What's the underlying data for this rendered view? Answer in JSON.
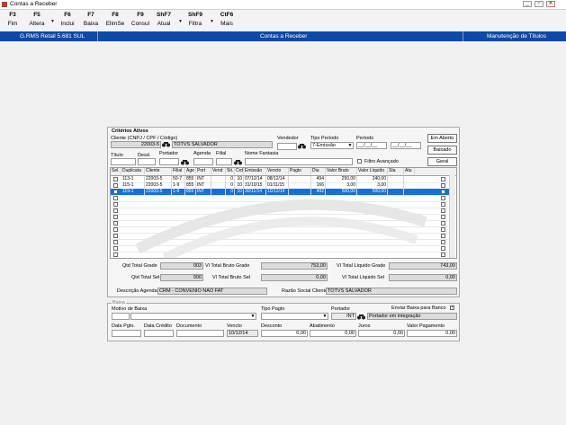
{
  "window": {
    "title": "Contas a Receber",
    "controls": [
      "_",
      "▫",
      "✕"
    ]
  },
  "toolbar": [
    {
      "key": "F3",
      "label": "Fim",
      "arrow": false
    },
    {
      "key": "F5",
      "label": "Altera",
      "arrow": true
    },
    {
      "key": "F6",
      "label": "Inclui",
      "arrow": false
    },
    {
      "key": "F7",
      "label": "Baixa",
      "arrow": false
    },
    {
      "key": "F8",
      "label": "ElimSe",
      "arrow": false
    },
    {
      "key": "F9",
      "label": "Consul",
      "arrow": false
    },
    {
      "key": "ShF7",
      "label": "Atual",
      "arrow": true
    },
    {
      "key": "ShF9",
      "label": "Filtra",
      "arrow": true
    },
    {
      "key": "CtF6",
      "label": "Mais",
      "arrow": false
    }
  ],
  "header_bar": {
    "product": "G.RMS Retail 5.681 SUL",
    "module": "Contas a Receber",
    "screen": "Manutenção de Títulos"
  },
  "criteria": {
    "section_title": "Critérios Ativos",
    "client_label": "Cliente (CNPJ / CPF / Código)",
    "client_code": "22003-5",
    "client_name": "TOTVS SALVADOR",
    "seller_label": "Vendedor",
    "seller_value": "",
    "period_type_label": "Tipo Período",
    "period_type_value": "7-Emissão",
    "period_label": "Período",
    "period_from": "__/__/__",
    "period_to": "__/__/__",
    "title_label": "Título",
    "desd_label": "Desd.",
    "portador_label": "Portador",
    "agenda_label": "Agenda",
    "filial_label": "Filial",
    "fantasia_label": "Nome Fantasia",
    "advanced_filter_label": "Filtro Avançado",
    "buttons": {
      "open": "Em Aberto",
      "paid": "Baixado",
      "general": "Geral"
    }
  },
  "grid": {
    "columns": [
      "Sel.",
      "Duplicata",
      "Cliente",
      "Filial",
      "Age",
      "Port",
      "Vend",
      "Sit.",
      "Crd",
      "Emissão",
      "Vencto",
      "Pagto",
      "Dia",
      "Valor Bruto",
      "Valor Líquido",
      "Sta",
      "Atu"
    ],
    "rows": [
      {
        "dup": "113-1",
        "cliente": "22003-5",
        "filial": "50-7",
        "age": "855",
        "port": "INT",
        "vend": "",
        "sit": "0",
        "crd": "10",
        "emissao": "07/12/14",
        "vencto": "08/12/14",
        "pagto": "",
        "dia": "494",
        "bruto": "250,00",
        "liquido": "240,00",
        "sta": "",
        "selected": false
      },
      {
        "dup": "115-1",
        "cliente": "22003-5",
        "filial": "1-9",
        "age": "855",
        "port": "INT",
        "vend": "",
        "sit": "0",
        "crd": "10",
        "emissao": "31/10/15",
        "vencto": "01/11/15",
        "pagto": "",
        "dia": "166",
        "bruto": "3,00",
        "liquido": "3,00",
        "sta": "",
        "selected": false
      },
      {
        "dup": "119-1",
        "cliente": "22003-5",
        "filial": "1-9",
        "age": "855",
        "port": "INT",
        "vend": "",
        "sit": "0",
        "crd": "10",
        "emissao": "30/11/14",
        "vencto": "10/12/14",
        "pagto": "",
        "dia": "492",
        "bruto": "500,00",
        "liquido": "500,00",
        "sta": "",
        "selected": true
      }
    ]
  },
  "totals": {
    "qtd_grade_label": "Qtd Total Grade",
    "qtd_grade": "003",
    "qtd_sel_label": "Qtd Total Sel",
    "qtd_sel": "000",
    "bruto_grade_label": "Vl Total Bruto Grade",
    "bruto_grade": "753,00",
    "bruto_sel_label": "Vl Total Bruto Sel",
    "bruto_sel": "0,00",
    "liquido_grade_label": "Vl Total Líquido Grade",
    "liquido_grade": "743,00",
    "liquido_sel_label": "Vl Total Líquido Sel",
    "liquido_sel": "0,00",
    "agenda_label": "Descrição Agenda",
    "agenda_value": "CRM - CONVENIO NAO FAT",
    "razao_label": "Razão Social Cliente",
    "razao_value": "TOTVS SALVADOR"
  },
  "baixa": {
    "section_title": "Baixa",
    "motivo_label": "Motivo de Baixa",
    "tipo_pagto_label": "Tipo Pagto",
    "portador_label": "Portador",
    "portador_code": "INT",
    "portador_name": "Portador em integração",
    "enviar_label": "Enviar Baixa para Banco",
    "data_pgto_label": "Data Pgto.",
    "data_credito_label": "Data Crédito",
    "documento_label": "Documento",
    "vencto_label": "Vencto",
    "vencto_value": "10/12/14",
    "desconto_label": "Desconto",
    "desconto_value": "0,00",
    "abatimento_label": "Abatimento",
    "abatimento_value": "0,00",
    "juros_label": "Juros",
    "juros_value": "0,00",
    "valor_pagamento_label": "Valor Pagamento",
    "valor_pagamento_value": "0,00"
  }
}
